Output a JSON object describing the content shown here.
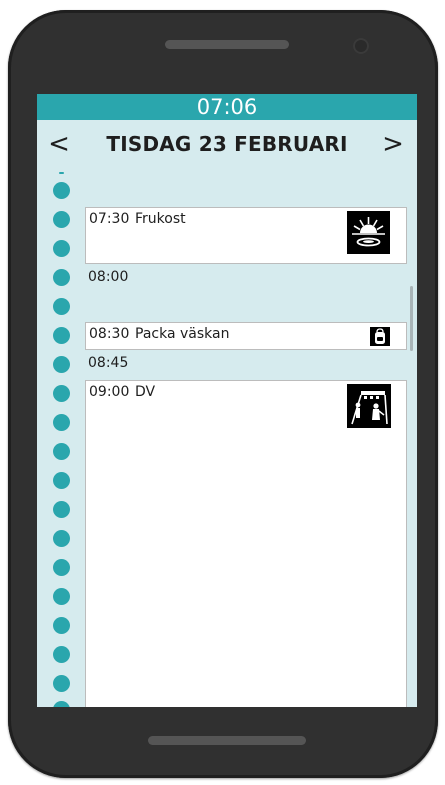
{
  "status_bar": {
    "time": "07:06"
  },
  "header": {
    "date_title": "TISDAG 23 FEBRUARI",
    "prev_label": "<",
    "next_label": ">"
  },
  "events": [
    {
      "time": "07:30",
      "title": "Frukost",
      "icon": "sunrise-breakfast-icon"
    },
    {
      "time": "08:30",
      "title": "Packa väskan",
      "icon": "backpack-icon"
    },
    {
      "time": "09:00",
      "title": "DV",
      "icon": "school-activity-icon"
    }
  ],
  "time_markers": [
    "08:00",
    "08:45"
  ],
  "colors": {
    "accent": "#2aa6ad",
    "screen_background": "#d6ebee",
    "phone_body": "#303030",
    "card_background": "#ffffff"
  }
}
